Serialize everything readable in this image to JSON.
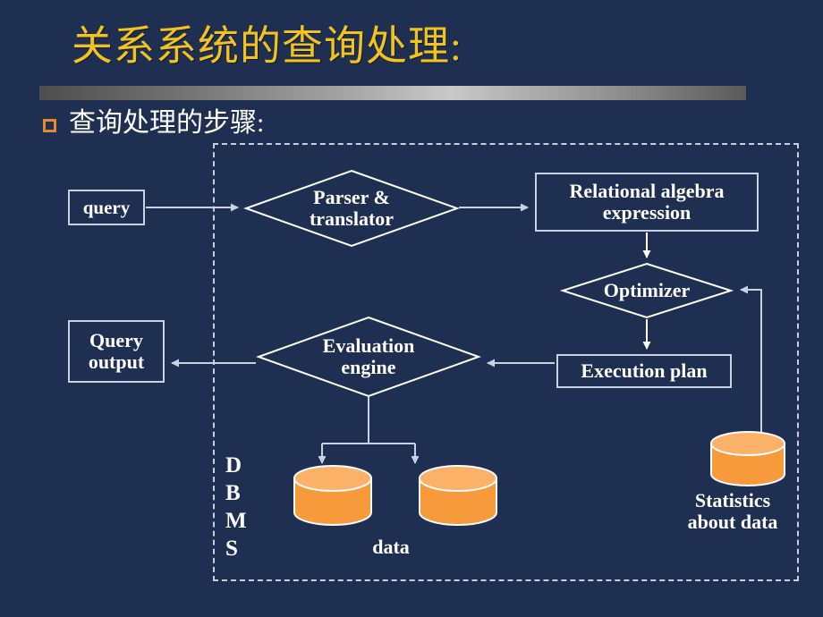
{
  "slide": {
    "title": "关系系统的查询处理:",
    "title_color": "#f2c220",
    "background_color": "#1e2f52",
    "bullet": {
      "marker": "hollow-square",
      "marker_color": "#e8862a",
      "text": "查询处理的步骤:"
    }
  },
  "diagram": {
    "region_label": "DBMS",
    "dbms_letters": "D\nB\nM\nS",
    "nodes": {
      "query": "query",
      "parser_translator": "Parser &\ntranslator",
      "relational_algebra": "Relational algebra\nexpression",
      "optimizer": "Optimizer",
      "execution_plan": "Execution plan",
      "evaluation_engine": "Evaluation\nengine",
      "query_output": "Query\noutput",
      "data_label": "data",
      "statistics_label": "Statistics\nabout data"
    },
    "cylinder_color": "#f79a3c",
    "cylinder_top_color": "#fbb268",
    "line_color": "#c9d2e2"
  }
}
